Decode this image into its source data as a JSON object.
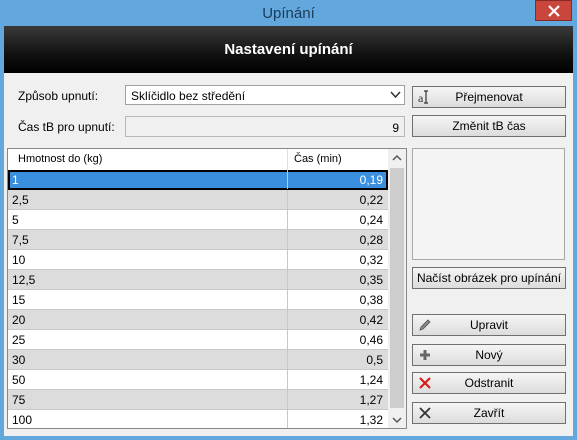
{
  "window": {
    "title": "Upínání"
  },
  "header": {
    "title": "Nastavení upínání"
  },
  "form": {
    "mode_label": "Způsob upnutí:",
    "mode_value": "Sklíčidlo bez středění",
    "time_label": "Čas tB pro upnutí:",
    "time_value": "9"
  },
  "buttons": {
    "rename": "Přejmenovat",
    "change_time": "Změnit tB čas",
    "load_image": "Načíst obrázek pro upínání",
    "edit": "Upravit",
    "new": "Nový",
    "remove": "Odstranit",
    "close": "Zavřít"
  },
  "table": {
    "columns": [
      "Hmotnost do (kg)",
      "Čas (min)"
    ],
    "rows": [
      [
        "1",
        "0,19"
      ],
      [
        "2,5",
        "0,22"
      ],
      [
        "5",
        "0,24"
      ],
      [
        "7,5",
        "0,28"
      ],
      [
        "10",
        "0,32"
      ],
      [
        "12,5",
        "0,35"
      ],
      [
        "15",
        "0,38"
      ],
      [
        "20",
        "0,42"
      ],
      [
        "25",
        "0,46"
      ],
      [
        "30",
        "0,5"
      ],
      [
        "50",
        "1,24"
      ],
      [
        "75",
        "1,27"
      ],
      [
        "100",
        "1,32"
      ]
    ]
  },
  "icons": {
    "close": "close-icon",
    "dropdown": "chevron-down-icon",
    "rename": "text-cursor-icon",
    "edit": "pencil-icon",
    "new": "plus-icon",
    "remove": "red-x-icon",
    "close_btn": "x-icon"
  }
}
